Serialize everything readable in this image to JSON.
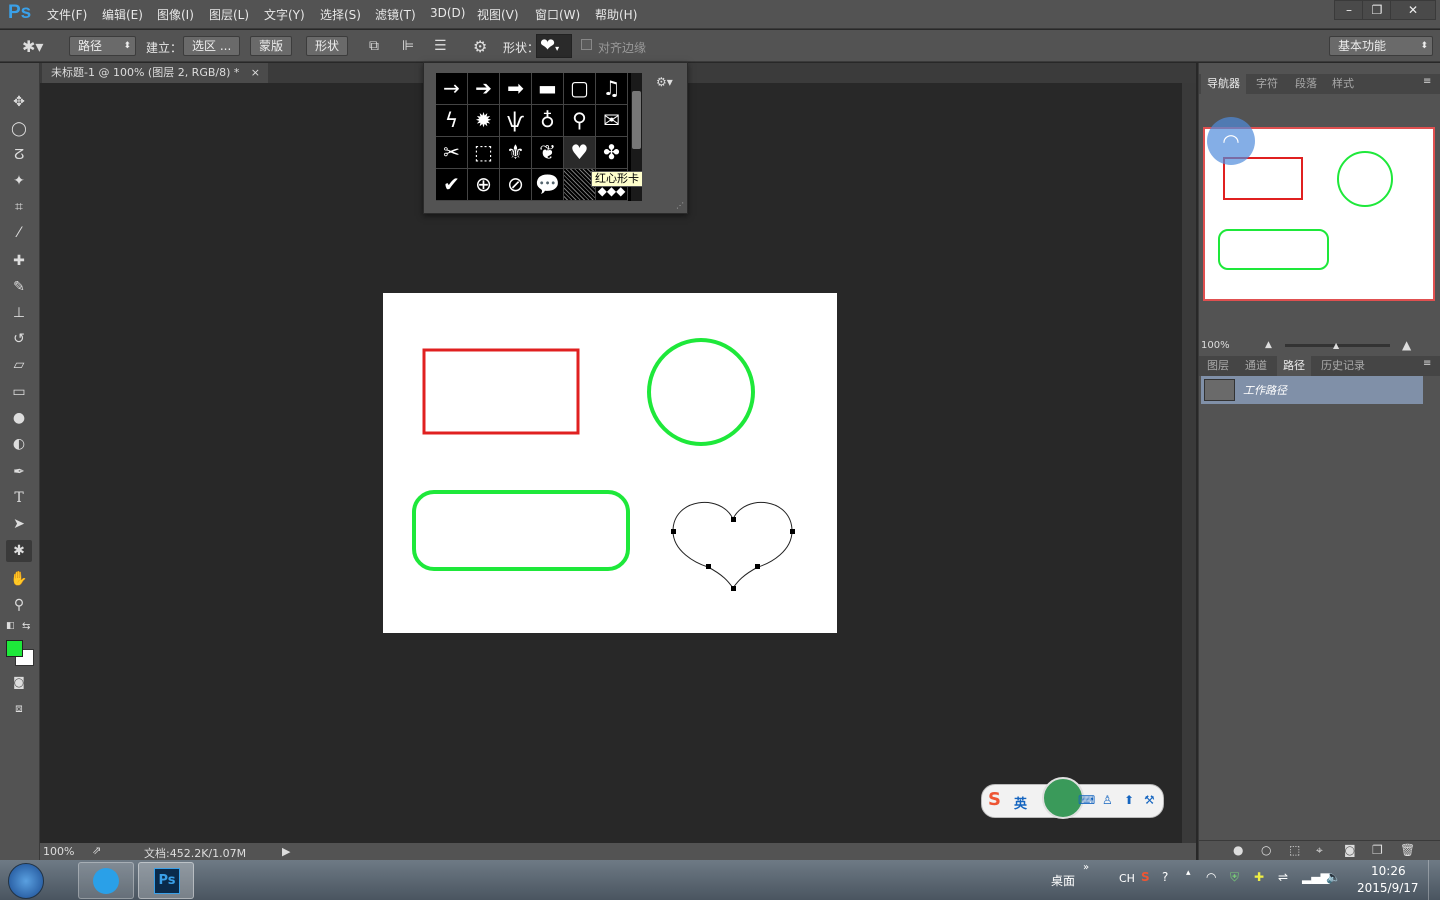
{
  "app": {
    "logo": "Ps"
  },
  "menu": [
    "文件(F)",
    "编辑(E)",
    "图像(I)",
    "图层(L)",
    "文字(Y)",
    "选择(S)",
    "滤镜(T)",
    "3D(D)",
    "视图(V)",
    "窗口(W)",
    "帮助(H)"
  ],
  "window_controls": {
    "minimize": "–",
    "restore": "❐",
    "close": "✕"
  },
  "options": {
    "mode": "路径",
    "build_label": "建立：",
    "selection_btn": "选区 ...",
    "mask_btn": "蒙版",
    "shape_btn": "形状",
    "shape_label": "形状：",
    "align_edges": "对齐边缘",
    "workspace": "基本功能"
  },
  "document": {
    "tab_title": "未标题-1 @ 100% (图层 2, RGB/8) *",
    "tab_close": "×"
  },
  "shape_popup": {
    "tooltip": "红心形卡"
  },
  "panels": {
    "top_tabs": [
      "导航器",
      "字符",
      "段落",
      "样式"
    ],
    "zoom": "100%",
    "bottom_tabs": [
      "图层",
      "通道",
      "路径",
      "历史记录"
    ],
    "path_item": "工作路径"
  },
  "status": {
    "zoom": "100%",
    "doc_info": "文档:452.2K/1.07M"
  },
  "taskbar": {
    "desktop": "桌面",
    "lang": "CH",
    "time": "10:26",
    "date": "2015/9/17",
    "ime": "英"
  },
  "colors": {
    "foreground": "#1ee83a",
    "background": "#ffffff",
    "rect": "#e02020",
    "green": "#1ee83a"
  }
}
